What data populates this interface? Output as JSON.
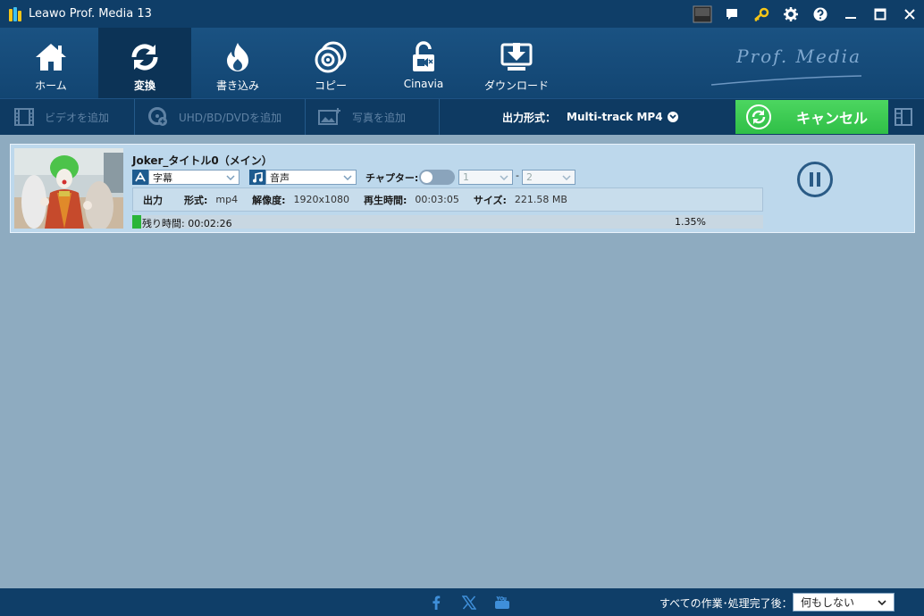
{
  "window": {
    "title": "Leawo Prof. Media 13",
    "controls": [
      "amd-badge-icon",
      "chat-icon",
      "key-icon",
      "gear-icon",
      "help-icon",
      "minimize-icon",
      "maximize-icon",
      "close-icon"
    ]
  },
  "nav": {
    "items": [
      {
        "label": "ホーム",
        "icon": "home-icon"
      },
      {
        "label": "変換",
        "icon": "convert-icon",
        "active": true
      },
      {
        "label": "書き込み",
        "icon": "burn-icon"
      },
      {
        "label": "コピー",
        "icon": "copy-disc-icon"
      },
      {
        "label": "Cinavia",
        "icon": "cinavia-lock-icon"
      },
      {
        "label": "ダウンロード",
        "icon": "download-icon"
      }
    ],
    "brand": "Prof. Media"
  },
  "toolbar": {
    "add_video": "ビデオを追加",
    "add_disc": "UHD/BD/DVDを追加",
    "add_photo": "写真を追加",
    "output_label": "出力形式：",
    "output_value": "Multi-track MP4",
    "cancel": "キャンセル"
  },
  "item": {
    "title": "Joker_タイトル0（メイン）",
    "subtitle_value": "字幕",
    "audio_value": "音声",
    "chapter_label": "チャプター:",
    "chapter_from": "1",
    "chapter_sep": "-",
    "chapter_to": "2",
    "output_label": "出力",
    "format_label": "形式:",
    "format_value": "mp4",
    "resolution_label": "解像度:",
    "resolution_value": "1920x1080",
    "duration_label": "再生時間:",
    "duration_value": "00:03:05",
    "size_label": "サイズ:",
    "size_value": "221.58 MB",
    "remaining": "残り時間: 00:02:26",
    "progress_percent": "1.35%",
    "progress_fraction": 0.0135
  },
  "statusbar": {
    "after_label": "すべての作業･処理完了後：",
    "after_value": "何もしない"
  },
  "colors": {
    "titlebar": "#0f3e68",
    "accent_green": "#2fbf47",
    "content_bg": "#8eabc0"
  }
}
